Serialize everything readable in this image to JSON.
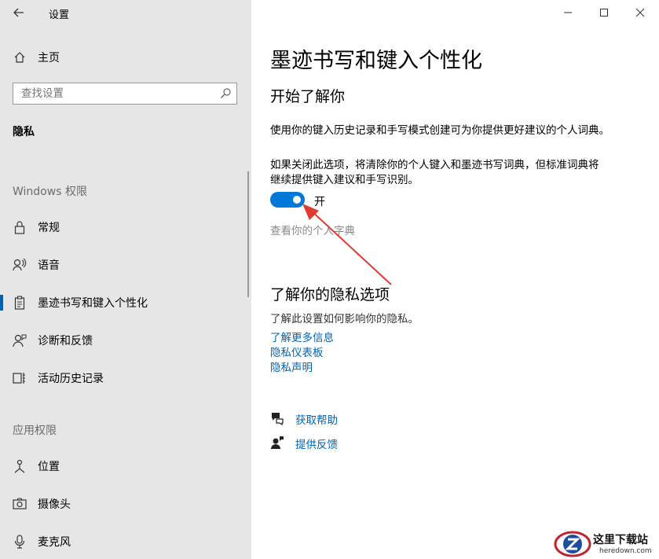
{
  "window": {
    "title": "设置",
    "back_icon": "back-arrow-icon"
  },
  "sidebar": {
    "home_label": "主页",
    "search_placeholder": "查找设置",
    "category": "隐私",
    "windows_permissions_header": "Windows 权限",
    "windows_items": [
      {
        "label": "常规",
        "icon": "lock-icon"
      },
      {
        "label": "语音",
        "icon": "speech-icon"
      },
      {
        "label": "墨迹书写和键入个性化",
        "icon": "clipboard-icon",
        "selected": true
      },
      {
        "label": "诊断和反馈",
        "icon": "feedback-person-icon"
      },
      {
        "label": "活动历史记录",
        "icon": "timeline-icon"
      }
    ],
    "app_permissions_header": "应用权限",
    "app_items": [
      {
        "label": "位置",
        "icon": "location-icon"
      },
      {
        "label": "摄像头",
        "icon": "camera-icon"
      },
      {
        "label": "麦克风",
        "icon": "microphone-icon"
      }
    ]
  },
  "main": {
    "title": "墨迹书写和键入个性化",
    "section1_title": "开始了解你",
    "desc1": "使用你的键入历史记录和手写模式创建可为你提供更好建议的个人词典。",
    "desc2_line1": "如果关闭此选项，将清除你的个人键入和墨迹书写词典，但标准词典将",
    "desc2_line2": "继续提供键入建议和手写识别。",
    "toggle": {
      "state": "开",
      "on": true
    },
    "view_dictionary": "查看你的个人字典",
    "section2_title": "了解你的隐私选项",
    "privacy_desc": "了解此设置如何影响你的隐私。",
    "links": [
      "了解更多信息",
      "隐私仪表板",
      "隐私声明"
    ],
    "get_help": "获取帮助",
    "give_feedback": "提供反馈"
  },
  "watermark": {
    "site_cn": "这里下载站",
    "site_en": "heredown.com"
  },
  "colors": {
    "accent": "#0063b1",
    "toggle_on": "#0078d7",
    "sidebar_bg": "#e6e6e6",
    "arrow": "#e03c31"
  }
}
